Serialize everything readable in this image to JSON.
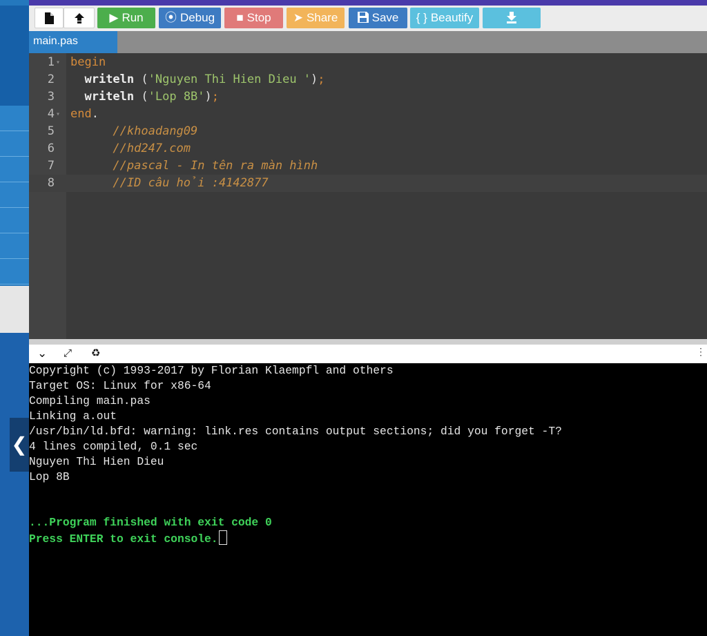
{
  "toolbar": {
    "run_label": "Run",
    "debug_label": "Debug",
    "stop_label": "Stop",
    "share_label": "Share",
    "save_label": "Save",
    "beautify_label": "Beautify",
    "beautify_icon": "{ }"
  },
  "tabs": [
    {
      "label": "main.pas"
    }
  ],
  "editor": {
    "line_numbers": [
      "1",
      "2",
      "3",
      "4",
      "5",
      "6",
      "7",
      "8"
    ],
    "code": {
      "begin": "begin",
      "writeln": "writeln",
      "str1": "'Nguyen Thi Hien Dieu '",
      "str2": "'Lop 8B'",
      "end": "end",
      "c1": "//khoadang09",
      "c2": "//hd247.com",
      "c3": "//pascal - In tên ra màn hình",
      "c4": "//ID câu hỏi :4142877"
    }
  },
  "console": {
    "lines": [
      "Copyright (c) 1993-2017 by Florian Klaempfl and others",
      "Target OS: Linux for x86-64",
      "Compiling main.pas",
      "Linking a.out",
      "/usr/bin/ld.bfd: warning: link.res contains output sections; did you forget -T?",
      "4 lines compiled, 0.1 sec",
      "Nguyen Thi Hien Dieu",
      "Lop 8B"
    ],
    "finished": "...Program finished with exit code 0",
    "press_enter": "Press ENTER to exit console."
  },
  "colors": {
    "run": "#4cae4c",
    "debug": "#3d7bc2",
    "stop": "#e07a79",
    "share": "#f2b45a",
    "save": "#3d7bc2",
    "beautify": "#5bc0de",
    "tab": "#2d80c6",
    "keyword": "#d58b3b",
    "string": "#9ec56c",
    "comment": "#c99045",
    "console_success": "#3fd35a"
  },
  "icons": [
    "new-file-icon",
    "upload-icon",
    "play-icon",
    "debug-icon",
    "stop-icon",
    "share-icon",
    "save-icon",
    "download-icon",
    "collapse-chevron-icon",
    "expand-icon",
    "clear-console-icon",
    "chevron-left-icon"
  ]
}
